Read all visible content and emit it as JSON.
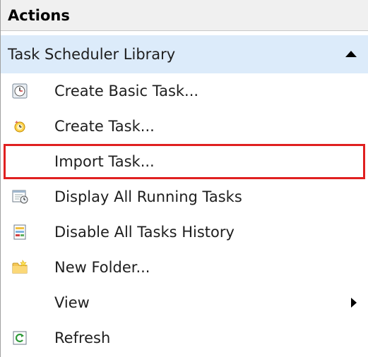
{
  "header": {
    "title": "Actions"
  },
  "section": {
    "title": "Task Scheduler Library"
  },
  "items": [
    {
      "label": "Create Basic Task...",
      "icon": "clock-wizard-icon"
    },
    {
      "label": "Create Task...",
      "icon": "task-clock-icon"
    },
    {
      "label": "Import Task...",
      "icon": "",
      "highlighted": true
    },
    {
      "label": "Display All Running Tasks",
      "icon": "running-tasks-icon"
    },
    {
      "label": "Disable All Tasks History",
      "icon": "history-icon"
    },
    {
      "label": "New Folder...",
      "icon": "folder-icon"
    },
    {
      "label": "View",
      "icon": "",
      "has_submenu": true
    },
    {
      "label": "Refresh",
      "icon": "refresh-icon"
    }
  ],
  "colors": {
    "section_bg": "#dcebfa",
    "highlight_border": "#e02020",
    "header_bg": "#f0f0f0"
  }
}
